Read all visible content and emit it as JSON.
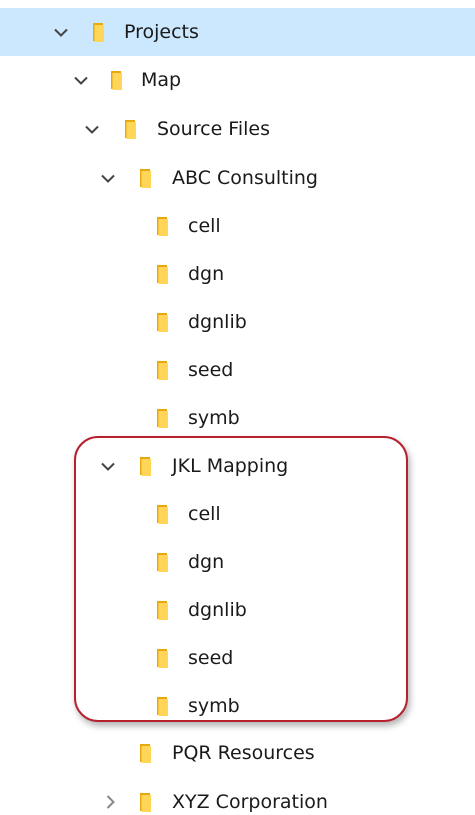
{
  "tree": {
    "nodes": [
      {
        "label": "Projects",
        "state": "expanded",
        "selected": true
      },
      {
        "label": "Map",
        "state": "expanded"
      },
      {
        "label": "Source Files",
        "state": "expanded"
      },
      {
        "label": "ABC Consulting",
        "state": "expanded"
      },
      {
        "label": "cell",
        "state": "leaf"
      },
      {
        "label": "dgn",
        "state": "leaf"
      },
      {
        "label": "dgnlib",
        "state": "leaf"
      },
      {
        "label": "seed",
        "state": "leaf"
      },
      {
        "label": "symb",
        "state": "leaf"
      },
      {
        "label": "JKL Mapping",
        "state": "expanded"
      },
      {
        "label": "cell",
        "state": "leaf"
      },
      {
        "label": "dgn",
        "state": "leaf"
      },
      {
        "label": "dgnlib",
        "state": "leaf"
      },
      {
        "label": "seed",
        "state": "leaf"
      },
      {
        "label": "symb",
        "state": "leaf"
      },
      {
        "label": "PQR Resources",
        "state": "leaf"
      },
      {
        "label": "XYZ Corporation",
        "state": "collapsed"
      }
    ]
  },
  "icons": {
    "expanded": "chevron-down-icon",
    "collapsed": "chevron-right-icon",
    "folder": "folder-icon"
  },
  "colors": {
    "selection": "#cce8ff",
    "folder_front": "#ffd65a",
    "folder_back": "#e8a90e",
    "highlight_ring": "#b7202e",
    "chevron": "#444444"
  }
}
